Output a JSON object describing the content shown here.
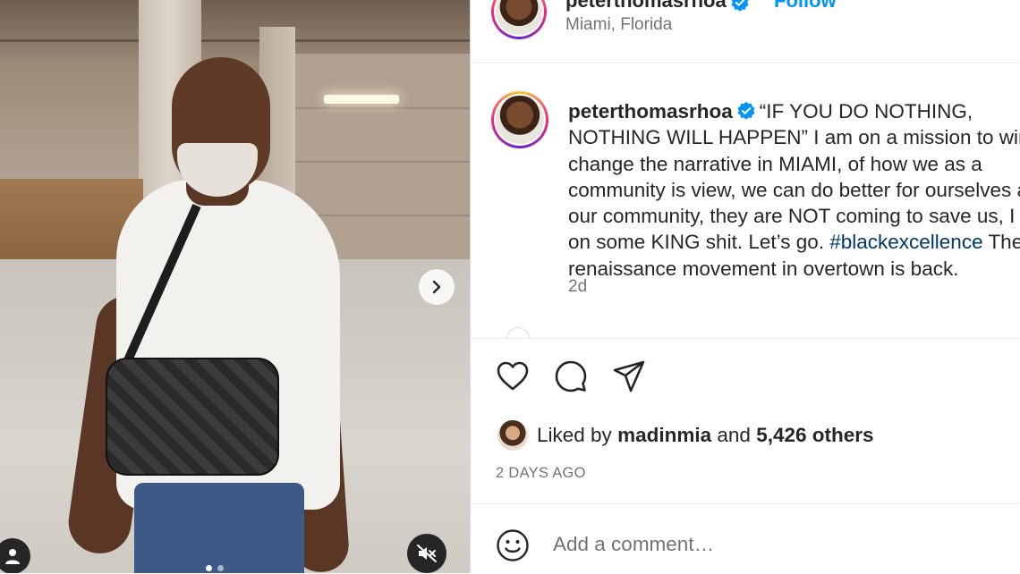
{
  "post": {
    "username": "peterthomasrhoa",
    "follow_label": "Follow",
    "location": "Miami, Florida",
    "caption_username": "peterthomasrhoa",
    "caption_text": "“IF YOU DO NOTHING, NOTHING WILL HAPPEN” I am on a mission to win, to change the narrative in MIAMI, of how we as a community is view, we can do better for ourselves and our community, they are NOT coming to save us, I am on some KING shit. Let’s go. ",
    "caption_hashtag": "#blackexcellence",
    "caption_after_tag": " The renaissance movement in overtown is back.",
    "time_ago": "2d"
  },
  "likes": {
    "prefix": "Liked by",
    "user": "madinmia",
    "conj": "and",
    "others": "5,426 others"
  },
  "date_label": "2 DAYS AGO",
  "comment": {
    "placeholder": "Add a comment…"
  },
  "colors": {
    "accent": "#0095f6",
    "verified": "#0095f6",
    "hashtag": "#00376b",
    "muted": "#737373"
  },
  "icons": {
    "like": "heart-icon",
    "comment": "comment-bubble-icon",
    "share": "paper-plane-icon",
    "emoji": "smiley-icon",
    "next": "chevron-right-icon",
    "mute": "speaker-muted-icon",
    "tags": "user-tag-icon"
  },
  "media": {
    "slide_count": 2,
    "active_slide": 1
  }
}
